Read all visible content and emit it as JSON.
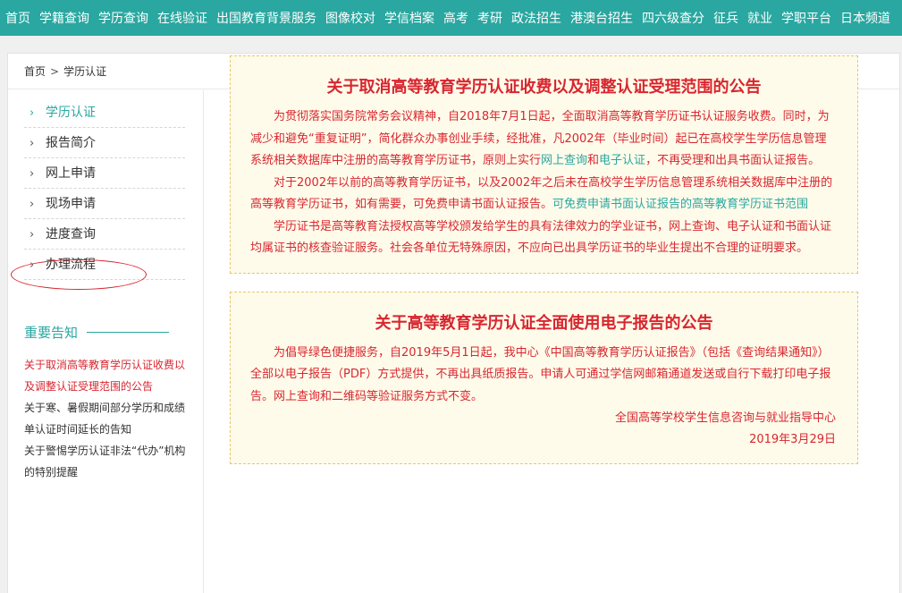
{
  "topnav": [
    "首页",
    "学籍查询",
    "学历查询",
    "在线验证",
    "出国教育背景服务",
    "图像校对",
    "学信档案",
    "高考",
    "考研",
    "政法招生",
    "港澳台招生",
    "四六级查分",
    "征兵",
    "就业",
    "学职平台",
    "日本频道"
  ],
  "breadcrumb": {
    "home": "首页",
    "sep": ">",
    "current": "学历认证"
  },
  "sidebar": {
    "items": [
      "学历认证",
      "报告简介",
      "网上申请",
      "现场申请",
      "进度查询",
      "办理流程"
    ],
    "notice_title": "重要告知",
    "notices": [
      "关于取消高等教育学历认证收费以及调整认证受理范围的公告",
      "关于寒、暑假期间部分学历和成绩单认证时间延长的告知",
      "关于警惕学历认证非法“代办”机构的特别提醒"
    ]
  },
  "ann1": {
    "title": "关于取消高等教育学历认证收费以及调整认证受理范围的公告",
    "p1_a": "为贯彻落实国务院常务会议精神，自2018年7月1日起，全面取消高等教育学历证书认证服务收费。同时，为减少和避免“重复证明”，简化群众办事创业手续，经批准，凡2002年（毕业时间）起已在高校学生学历信息管理系统相关数据库中注册的高等教育学历证书，原则上实行",
    "p1_link1": "网上查询",
    "p1_and": "和",
    "p1_link2": "电子认证",
    "p1_b": "，不再受理和出具书面认证报告。",
    "p2_a": "对于2002年以前的高等教育学历证书，以及2002年之后未在高校学生学历信息管理系统相关数据库中注册的高等教育学历证书，如有需要，可免费申请书面认证报告。",
    "p2_link": "可免费申请书面认证报告的高等教育学历证书范围",
    "p3": "学历证书是高等教育法授权高等学校颁发给学生的具有法律效力的学业证书，网上查询、电子认证和书面认证均属证书的核查验证服务。社会各单位无特殊原因，不应向已出具学历证书的毕业生提出不合理的证明要求。"
  },
  "ann2": {
    "title": "关于高等教育学历认证全面使用电子报告的公告",
    "p1": "为倡导绿色便捷服务，自2019年5月1日起，我中心《中国高等教育学历认证报告》（包括《查询结果通知》）全部以电子报告（PDF）方式提供，不再出具纸质报告。申请人可通过学信网邮箱通道发送或自行下载打印电子报告。网上查询和二维码等验证服务方式不变。",
    "org": "全国高等学校学生信息咨询与就业指导中心",
    "date": "2019年3月29日"
  }
}
